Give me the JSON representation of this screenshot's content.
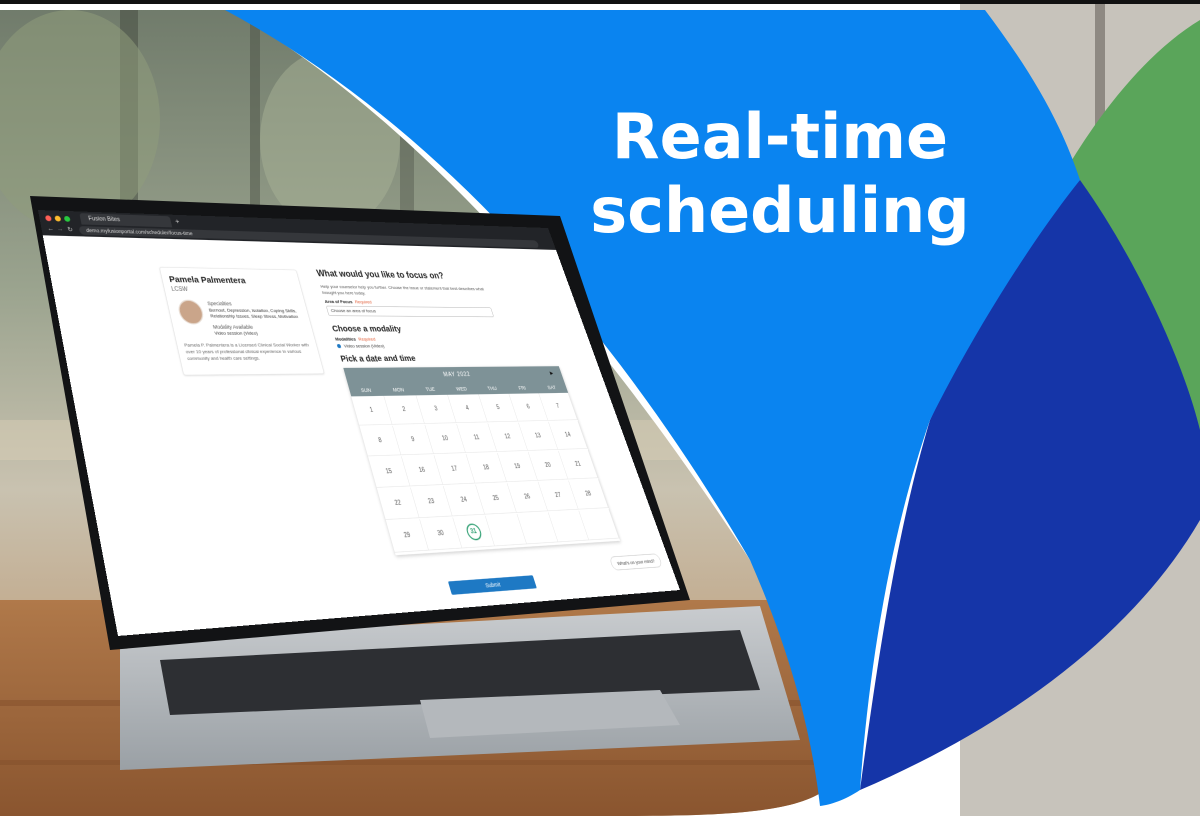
{
  "headline": {
    "line1": "Real-time",
    "line2": "scheduling"
  },
  "colors": {
    "bright_blue": "#0A84F0",
    "dark_blue": "#1535A8",
    "green": "#5AA55A",
    "calendar_header": "#7E9297",
    "submit_blue": "#1E79C4"
  },
  "browser": {
    "tab_title": "Fusion Bites",
    "url": "demo.myfusionportal.com/scheduler/focus-time"
  },
  "provider": {
    "name": "Pamela Palmentera",
    "credential": "LCSW",
    "specialties_label": "Specialties",
    "specialties": "Burnout, Depression, Isolation, Coping Skills, Relationship Issues, Sleep Stress, Motivation",
    "modality_label": "Modality Available",
    "modality_value": "Video session (Video)",
    "bio": "Pamela P. Palmentera is a Licensed Clinical Social Worker with over 10 years of professional clinical experience in various community and health care settings."
  },
  "focus": {
    "title": "What would you like to focus on?",
    "description": "Help your counselor help you further. Choose the issue or statement that best describes what brought you here today.",
    "field_label": "Area of Focus",
    "required": "Required",
    "placeholder": "Choose an area of focus"
  },
  "modality": {
    "title": "Choose a modality",
    "field_label": "Modalities",
    "required": "Required",
    "option": "Video session (Video)"
  },
  "datetime": {
    "title": "Pick a date and time"
  },
  "calendar": {
    "month_label": "MAY 2022",
    "weekdays": [
      "SUN",
      "MON",
      "TUE",
      "WED",
      "THU",
      "FRI",
      "SAT"
    ],
    "weeks": [
      [
        "1",
        "2",
        "3",
        "4",
        "5",
        "6",
        "7"
      ],
      [
        "8",
        "9",
        "10",
        "11",
        "12",
        "13",
        "14"
      ],
      [
        "15",
        "16",
        "17",
        "18",
        "19",
        "20",
        "21"
      ],
      [
        "22",
        "23",
        "24",
        "25",
        "26",
        "27",
        "28"
      ],
      [
        "29",
        "30",
        "31",
        "",
        "",
        "",
        ""
      ]
    ],
    "selected_day": "31"
  },
  "submit_label": "Submit",
  "chat_prompt": "What's on your mind?"
}
